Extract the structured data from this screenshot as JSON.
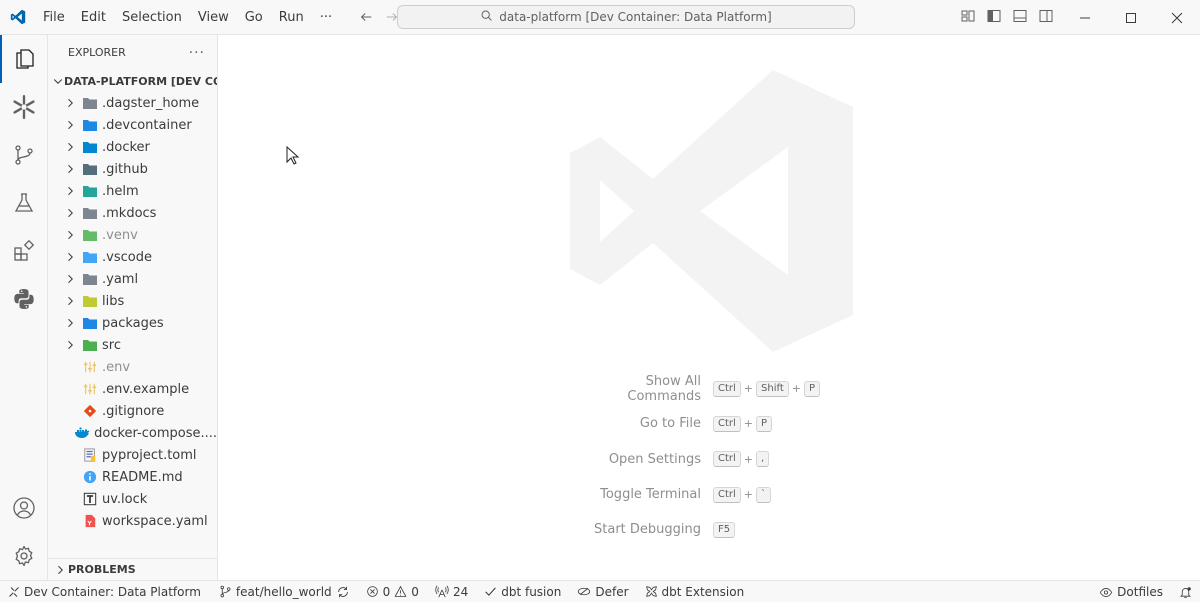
{
  "titlebar": {
    "menu": [
      "File",
      "Edit",
      "Selection",
      "View",
      "Go",
      "Run",
      "···"
    ],
    "search_text": "data-platform [Dev Container: Data Platform]"
  },
  "activitybar": {
    "items": [
      "explorer-icon",
      "snowflake-icon",
      "source-control-icon",
      "testing-icon",
      "extensions-icon",
      "python-icon"
    ],
    "bottom": [
      "accounts-icon",
      "settings-icon"
    ]
  },
  "sidebar": {
    "title": "EXPLORER",
    "more": "···",
    "workspace": "DATA-PLATFORM [DEV CO...",
    "folders": [
      {
        "name": ".dagster_home",
        "icon": "folder-icon",
        "color": "#7d8590",
        "dim": false
      },
      {
        "name": ".devcontainer",
        "icon": "folder-devcontainer-icon",
        "color": "#1e88e5",
        "dim": false
      },
      {
        "name": ".docker",
        "icon": "folder-docker-icon",
        "color": "#0288d1",
        "dim": false
      },
      {
        "name": ".github",
        "icon": "folder-github-icon",
        "color": "#546e7a",
        "dim": false
      },
      {
        "name": ".helm",
        "icon": "folder-helm-icon",
        "color": "#26a69a",
        "dim": false
      },
      {
        "name": ".mkdocs",
        "icon": "folder-icon",
        "color": "#7d8590",
        "dim": false
      },
      {
        "name": ".venv",
        "icon": "folder-venv-icon",
        "color": "#66bb6a",
        "dim": true
      },
      {
        "name": ".vscode",
        "icon": "folder-vscode-icon",
        "color": "#42a5f5",
        "dim": false
      },
      {
        "name": ".yaml",
        "icon": "folder-icon",
        "color": "#7d8590",
        "dim": false
      },
      {
        "name": "libs",
        "icon": "folder-lib-icon",
        "color": "#c0ca33",
        "dim": false
      },
      {
        "name": "packages",
        "icon": "folder-packages-icon",
        "color": "#1e88e5",
        "dim": false
      },
      {
        "name": "src",
        "icon": "folder-src-icon",
        "color": "#4caf50",
        "dim": false
      }
    ],
    "files": [
      {
        "name": ".env",
        "icon": "env-file-icon",
        "color": "#e9c46a",
        "dim": true
      },
      {
        "name": ".env.example",
        "icon": "env-file-icon",
        "color": "#e9c46a",
        "dim": false
      },
      {
        "name": ".gitignore",
        "icon": "git-file-icon",
        "color": "#e64a19",
        "dim": false
      },
      {
        "name": "docker-compose....",
        "icon": "docker-file-icon",
        "color": "#0288d1",
        "dim": false
      },
      {
        "name": "pyproject.toml",
        "icon": "toml-file-icon",
        "color": "#9e9e9e",
        "dim": false
      },
      {
        "name": "README.md",
        "icon": "info-file-icon",
        "color": "#42a5f5",
        "dim": false
      },
      {
        "name": "uv.lock",
        "icon": "lock-file-icon",
        "color": "#3b3b3b",
        "dim": false
      },
      {
        "name": "workspace.yaml",
        "icon": "yaml-file-icon",
        "color": "#ef5350",
        "dim": false
      }
    ],
    "problems": "PROBLEMS"
  },
  "editor": {
    "shortcuts": [
      {
        "label": "Show All Commands",
        "keys": [
          "Ctrl",
          "Shift",
          "P"
        ]
      },
      {
        "label": "Go to File",
        "keys": [
          "Ctrl",
          "P"
        ]
      },
      {
        "label": "Open Settings",
        "keys": [
          "Ctrl",
          ","
        ]
      },
      {
        "label": "Toggle Terminal",
        "keys": [
          "Ctrl",
          "`"
        ]
      },
      {
        "label": "Start Debugging",
        "keys": [
          "F5"
        ]
      }
    ]
  },
  "statusbar": {
    "remote": "Dev Container: Data Platform",
    "branch": "feat/hello_world",
    "errors": "0",
    "warnings": "0",
    "ports": "24",
    "dbt_fusion": "dbt fusion",
    "defer": "Defer",
    "dbt_extension": "dbt Extension",
    "dotfiles": "Dotfiles"
  },
  "colors": {
    "accent": "#005fb8",
    "vscode_blue": "#0065a9"
  }
}
